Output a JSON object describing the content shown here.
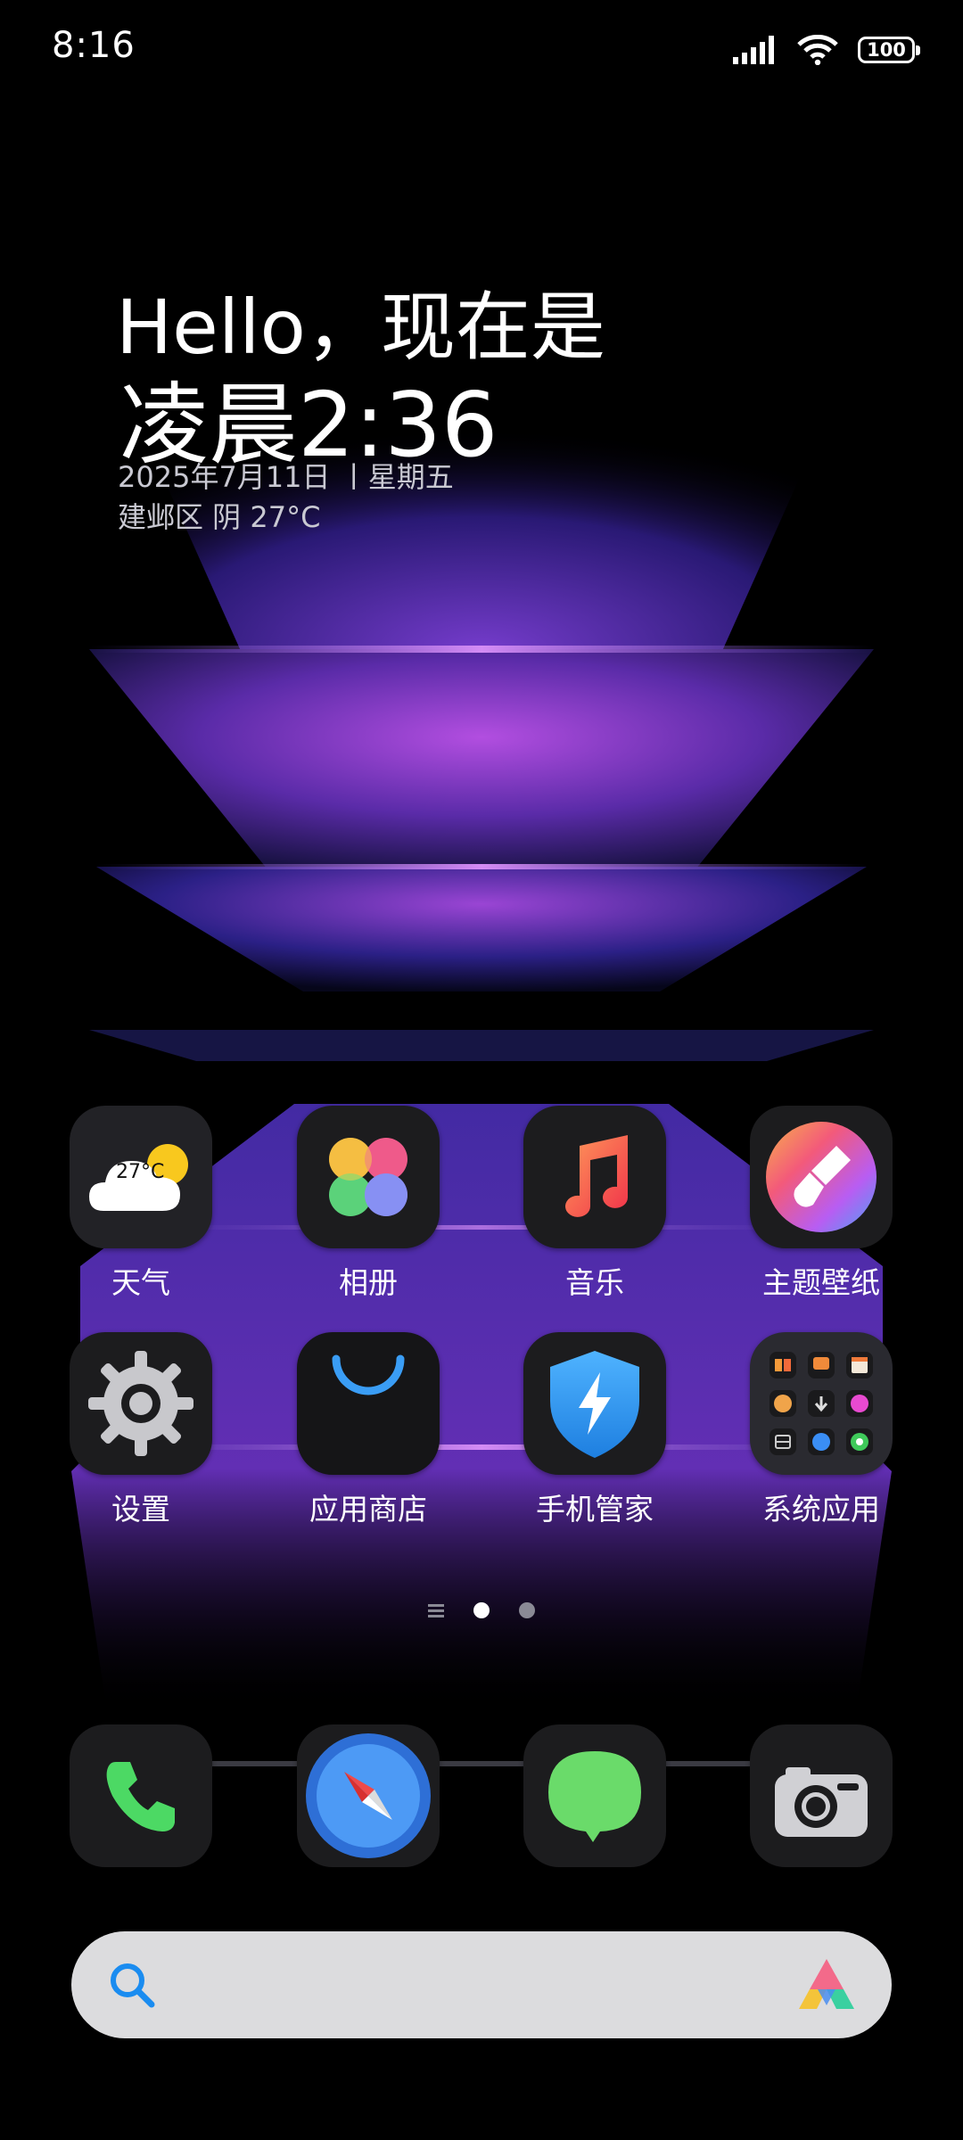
{
  "status_bar": {
    "time": "8:16",
    "battery": "100"
  },
  "greeting": {
    "line1": "Hello，现在是",
    "line2": "凌晨2:36",
    "date": "2025年7月11日 丨星期五",
    "weather": "建邺区  阴  27°C"
  },
  "apps": [
    {
      "label": "天气",
      "icon": "weather-icon",
      "badge": "27°C"
    },
    {
      "label": "相册",
      "icon": "gallery-icon"
    },
    {
      "label": "音乐",
      "icon": "music-icon"
    },
    {
      "label": "主题壁纸",
      "icon": "themes-icon"
    },
    {
      "label": "设置",
      "icon": "settings-gear-icon"
    },
    {
      "label": "应用商店",
      "icon": "app-store-icon"
    },
    {
      "label": "手机管家",
      "icon": "security-shield-icon"
    },
    {
      "label": "系统应用",
      "icon": "folder-icon"
    }
  ],
  "pager": {
    "pages": 3,
    "active_index": 1
  },
  "dock": [
    {
      "icon": "phone-icon"
    },
    {
      "icon": "browser-compass-icon"
    },
    {
      "icon": "messages-icon"
    },
    {
      "icon": "camera-icon"
    }
  ],
  "colors": {
    "accent": "#a24bd9",
    "search_bg": "#dcdcde",
    "phone_green": "#4cd964",
    "shield_blue": "#2f9bf0"
  }
}
